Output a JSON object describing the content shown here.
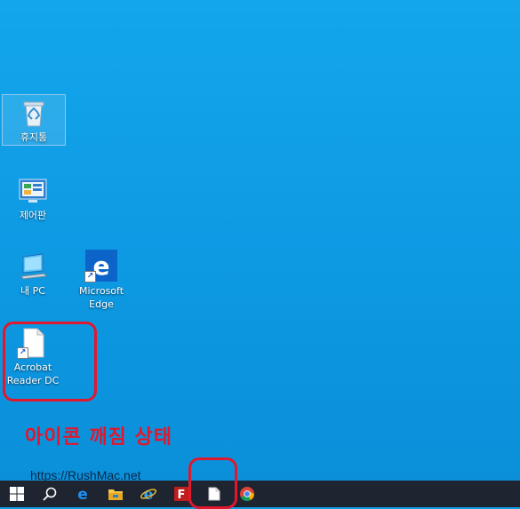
{
  "desktop": {
    "icons": [
      {
        "label": "휴지통",
        "icon": "recycle-bin-icon"
      },
      {
        "label": "제어판",
        "icon": "control-panel-icon"
      },
      {
        "label": "내 PC",
        "icon": "computer-icon"
      },
      {
        "label": "Microsoft Edge",
        "icon": "edge-icon"
      },
      {
        "label": "Acrobat Reader DC",
        "icon": "blank-file-icon"
      }
    ],
    "caption": "아이콘 깨짐 상태",
    "watermark": "https://RushMac.net"
  },
  "taskbar": {
    "items": [
      "start-icon",
      "search-icon",
      "edge-icon",
      "file-explorer-icon",
      "internet-explorer-icon",
      "filezilla-icon",
      "blank-file-icon",
      "chrome-icon"
    ]
  },
  "colors": {
    "desktop": "#0f9ee6",
    "taskbar": "#1e2530",
    "highlight_ring": "#e0182d"
  }
}
